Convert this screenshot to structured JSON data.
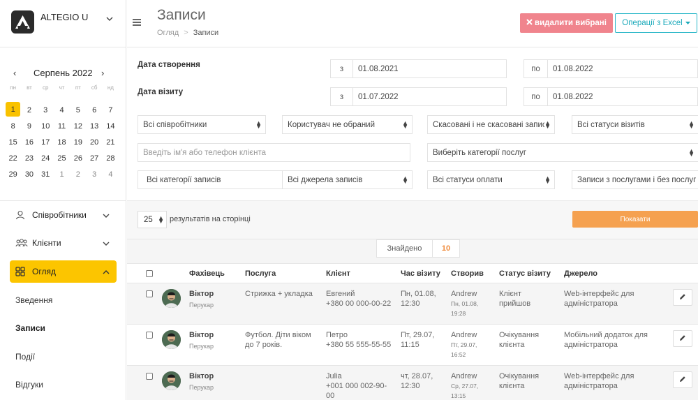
{
  "brand": {
    "name": "ALTEGIO U"
  },
  "calendar": {
    "prev": "‹",
    "next": "›",
    "month_label": "Серпень 2022",
    "weekdays": [
      "пн",
      "вт",
      "ср",
      "чт",
      "пт",
      "сб",
      "нд"
    ],
    "days": [
      "1",
      "2",
      "3",
      "4",
      "5",
      "6",
      "7",
      "8",
      "9",
      "10",
      "11",
      "12",
      "13",
      "14",
      "15",
      "16",
      "17",
      "18",
      "19",
      "20",
      "21",
      "22",
      "23",
      "24",
      "25",
      "26",
      "27",
      "28",
      "29",
      "30",
      "31",
      "1",
      "2",
      "3",
      "4"
    ],
    "selected": "1"
  },
  "nav": {
    "employees": "Співробітники",
    "clients": "Клієнти",
    "overview": "Огляд",
    "summary": "Зведення",
    "records": "Записи",
    "events": "Події",
    "reviews": "Відгуки"
  },
  "header": {
    "title": "Записи",
    "breadcrumb_root": "Огляд",
    "breadcrumb_sep": ">",
    "breadcrumb_current": "Записи",
    "delete_selected": "видалити вибрані",
    "excel_ops": "Операції з Excel"
  },
  "filters": {
    "created_label": "Дата створення",
    "visit_label": "Дата візиту",
    "from": "з",
    "to": "по",
    "created_from": "01.08.2021",
    "created_to": "01.08.2022",
    "visit_from": "01.07.2022",
    "visit_to": "01.08.2022",
    "all_employees": "Всі співробітники",
    "user_not_selected": "Користувач не обраний",
    "cancelled": "Скасовані і не скасовані записи",
    "visit_statuses": "Всі статуси візитів",
    "client_placeholder": "Введіть ім'я або телефон клієнта",
    "service_categories": "Виберіть категорії послуг",
    "record_categories": "Всі категорії записів",
    "record_sources": "Всі джерела записів",
    "payment_statuses": "Всі статуси оплати",
    "with_services": "Записи з послугами і без послуг"
  },
  "perpage": {
    "value": "25",
    "label": "результатів на сторінці",
    "show": "Показати"
  },
  "found": {
    "label": "Знайдено",
    "count": "10"
  },
  "table": {
    "headers": [
      "Фахівець",
      "Послуга",
      "Клієнт",
      "Час візиту",
      "Створив",
      "Статус візиту",
      "Джерело"
    ],
    "rows": [
      {
        "name": "Віктор",
        "role": "Перукар",
        "service": "Стрижка + укладка",
        "client": "Евгений",
        "phone": "+380 00 000-00-22",
        "time1": "Пн, 01.08,",
        "time2": "12:30",
        "creator": "Andrew",
        "created1": "Пн, 01.08,",
        "created2": "19:28",
        "status1": "Клієнт",
        "status2": "прийшов",
        "source1": "Web-інтерфейс для",
        "source2": "адміністратора"
      },
      {
        "name": "Віктор",
        "role": "Перукар",
        "service": "Футбол. Діти віком",
        "service2": "до 7 років.",
        "client": "Петро",
        "phone": "+380 55 555-55-55",
        "time1": "Пт, 29.07,",
        "time2": "11:15",
        "creator": "Andrew",
        "created1": "Пт, 29.07,",
        "created2": "16:52",
        "status1": "Очікування",
        "status2": "клієнта",
        "source1": "Мобільний додаток для",
        "source2": "адміністратора"
      },
      {
        "name": "Віктор",
        "role": "Перукар",
        "service": "",
        "client": "Julia",
        "phone": "+001 000 002-90-",
        "phone2": "00",
        "time1": "чт, 28.07,",
        "time2": "12:30",
        "creator": "Andrew",
        "created1": "Ср, 27.07,",
        "created2": "13:15",
        "status1": "Очікування",
        "status2": "клієнта",
        "source1": "Web-інтерфейс для",
        "source2": "адміністратора"
      }
    ]
  }
}
